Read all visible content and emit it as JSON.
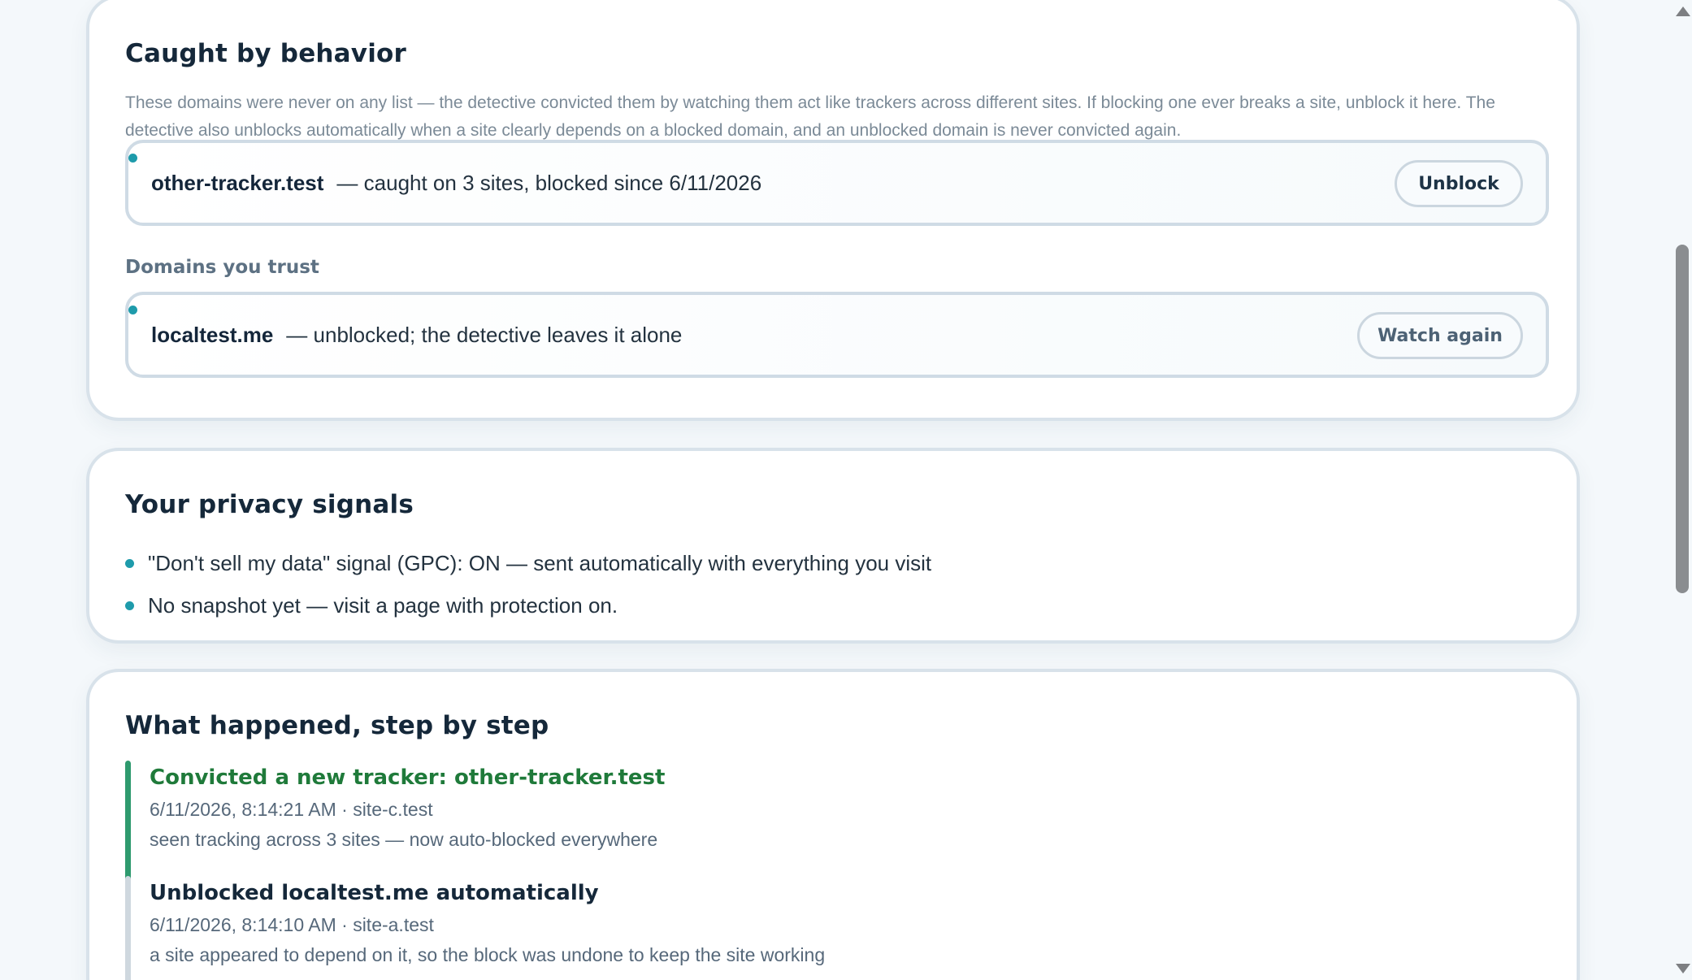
{
  "behavior": {
    "title": "Caught by behavior",
    "description": "These domains were never on any list — the detective convicted them by watching them act like trackers across different sites. If blocking one ever breaks a site, unblock it here. The detective also unblocks automatically when a site clearly depends on a blocked domain, and an unblocked domain is never convicted again.",
    "tracker": {
      "domain": "other-tracker.test",
      "summary": "— caught on 3 sites, blocked since 6/11/2026",
      "button_label": "Unblock"
    },
    "trusted_heading": "Domains you trust",
    "trusted": {
      "domain": "localtest.me",
      "summary": "— unblocked; the detective leaves it alone",
      "button_label": "Watch again"
    }
  },
  "privacy": {
    "title": "Your privacy signals",
    "items": [
      "\"Don't sell my data\" signal (GPC): ON — sent automatically with everything you visit",
      "No snapshot yet — visit a page with protection on."
    ]
  },
  "steps": {
    "title": "What happened, step by step",
    "events": [
      {
        "title": "Convicted a new tracker: other-tracker.test",
        "meta": "6/11/2026, 8:14:21 AM · site-c.test",
        "detail": "seen tracking across 3 sites — now auto-blocked everywhere"
      },
      {
        "title": "Unblocked localtest.me automatically",
        "meta": "6/11/2026, 8:14:10 AM · site-a.test",
        "detail": "a site appeared to depend on it, so the block was undone to keep the site working"
      }
    ]
  },
  "colors": {
    "accent_dot": "#1e9bab",
    "convicted_bar": "#2e9a6e",
    "convicted_title": "#1f7a3a",
    "neutral_bar": "#cfd8df"
  }
}
